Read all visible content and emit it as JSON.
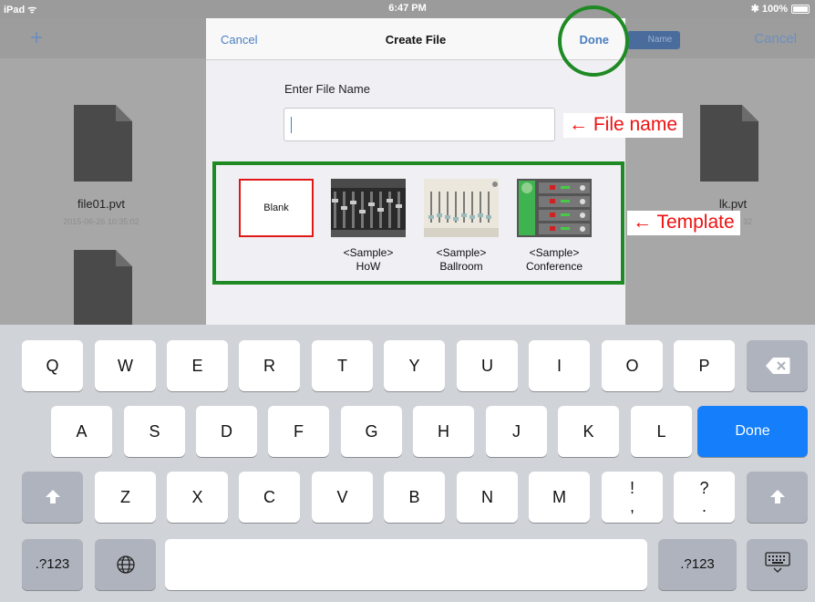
{
  "status_bar": {
    "device": "iPad ᯤ",
    "time": "6:47 PM",
    "battery": "✱ 100%"
  },
  "background": {
    "nav": {
      "add": "+",
      "segment": "Name",
      "cancel": "Cancel"
    },
    "files": [
      {
        "name": "file01.pvt",
        "date": "2015-06-26 10:35:02"
      },
      {
        "name": "lk.pvt",
        "date": "32"
      }
    ]
  },
  "modal": {
    "cancel": "Cancel",
    "title": "Create File",
    "done": "Done",
    "label": "Enter File Name",
    "input_value": "",
    "templates": [
      {
        "thumb": "Blank",
        "label": ""
      },
      {
        "thumb": "",
        "label": "<Sample>\nHoW"
      },
      {
        "thumb": "",
        "label": "<Sample>\nBallroom"
      },
      {
        "thumb": "",
        "label": "<Sample>\nConference"
      }
    ]
  },
  "annotations": {
    "file_name": "← File name",
    "template": "← Template"
  },
  "keyboard": {
    "row1": [
      "Q",
      "W",
      "E",
      "R",
      "T",
      "Y",
      "U",
      "I",
      "O",
      "P"
    ],
    "row2": [
      "A",
      "S",
      "D",
      "F",
      "G",
      "H",
      "J",
      "K",
      "L"
    ],
    "row3": [
      "Z",
      "X",
      "C",
      "V",
      "B",
      "N",
      "M"
    ],
    "done": "Done",
    "numbers": ".?123",
    "punct1": "!\n,",
    "punct2": "?\n."
  },
  "colors": {
    "accent": "#147efb",
    "annotation_green": "#1f8a24",
    "annotation_red": "#e01111"
  }
}
